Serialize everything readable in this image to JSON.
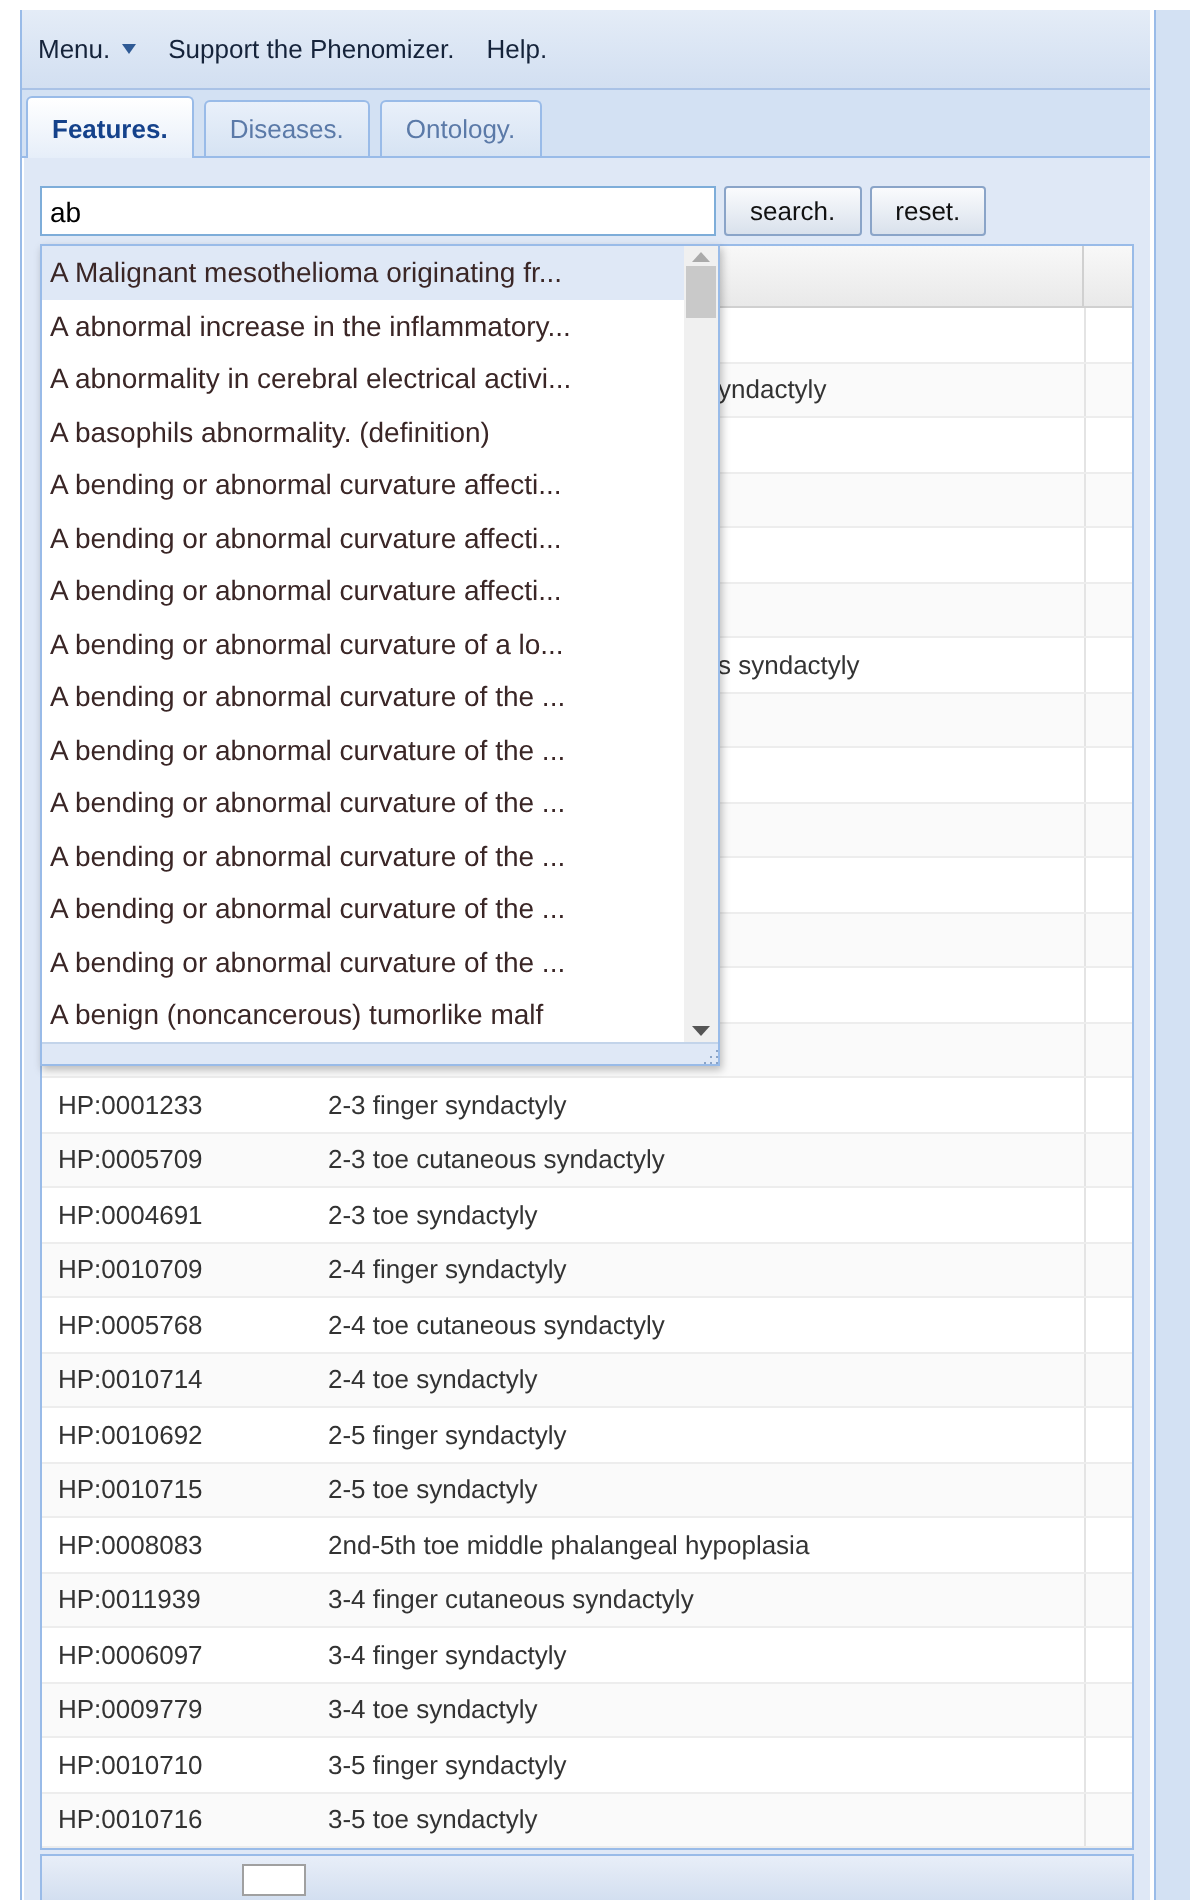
{
  "menu": [
    {
      "label": "Menu.",
      "kind": "dropdown"
    },
    {
      "label": "Support the Phenomizer.",
      "kind": "link"
    },
    {
      "label": "Help.",
      "kind": "link"
    }
  ],
  "tabs": [
    {
      "label": "Features.",
      "selected": true
    },
    {
      "label": "Diseases.",
      "selected": false
    },
    {
      "label": "Ontology.",
      "selected": false
    }
  ],
  "search": {
    "value": "ab",
    "buttons": [
      "search.",
      "reset."
    ]
  },
  "suggestions": [
    {
      "label": "A Malignant mesothelioma originating fr...",
      "selected": true
    },
    {
      "label": "A abnormal increase in the inflammatory...",
      "selected": false
    },
    {
      "label": "A abnormality in cerebral electrical activi...",
      "selected": false
    },
    {
      "label": "A basophils abnormality. (definition)",
      "selected": false
    },
    {
      "label": "A bending or abnormal curvature affecti...",
      "selected": false
    },
    {
      "label": "A bending or abnormal curvature affecti...",
      "selected": false
    },
    {
      "label": "A bending or abnormal curvature affecti...",
      "selected": false
    },
    {
      "label": "A bending or abnormal curvature of a lo...",
      "selected": false
    },
    {
      "label": "A bending or abnormal curvature of the ...",
      "selected": false
    },
    {
      "label": "A bending or abnormal curvature of the ...",
      "selected": false
    },
    {
      "label": "A bending or abnormal curvature of the ...",
      "selected": false
    },
    {
      "label": "A bending or abnormal curvature of the ...",
      "selected": false
    },
    {
      "label": "A bending or abnormal curvature of the ...",
      "selected": false
    },
    {
      "label": "A bending or abnormal curvature of the ...",
      "selected": false
    },
    {
      "label": "A benign (noncancerous) tumorlike malf",
      "selected": false
    }
  ],
  "grid": {
    "rows": [
      {
        "kind": "covered"
      },
      {
        "kind": "covered",
        "visible_text": "yndactyly"
      },
      {
        "kind": "covered"
      },
      {
        "kind": "covered"
      },
      {
        "kind": "covered"
      },
      {
        "kind": "covered"
      },
      {
        "kind": "covered",
        "visible_text": "s syndactyly"
      },
      {
        "kind": "covered"
      },
      {
        "kind": "covered"
      },
      {
        "kind": "covered"
      },
      {
        "kind": "covered"
      },
      {
        "kind": "covered"
      },
      {
        "kind": "covered"
      },
      {
        "kind": "covered"
      },
      {
        "kind": "term",
        "id": "HP:0001233",
        "name": "2-3 finger syndactyly"
      },
      {
        "kind": "term",
        "id": "HP:0005709",
        "name": "2-3 toe cutaneous syndactyly"
      },
      {
        "kind": "term",
        "id": "HP:0004691",
        "name": "2-3 toe syndactyly"
      },
      {
        "kind": "term",
        "id": "HP:0010709",
        "name": "2-4 finger syndactyly"
      },
      {
        "kind": "term",
        "id": "HP:0005768",
        "name": "2-4 toe cutaneous syndactyly"
      },
      {
        "kind": "term",
        "id": "HP:0010714",
        "name": "2-4 toe syndactyly"
      },
      {
        "kind": "term",
        "id": "HP:0010692",
        "name": "2-5 finger syndactyly"
      },
      {
        "kind": "term",
        "id": "HP:0010715",
        "name": "2-5 toe syndactyly"
      },
      {
        "kind": "term",
        "id": "HP:0008083",
        "name": "2nd-5th toe middle phalangeal hypoplasia"
      },
      {
        "kind": "term",
        "id": "HP:0011939",
        "name": "3-4 finger cutaneous syndactyly"
      },
      {
        "kind": "term",
        "id": "HP:0006097",
        "name": "3-4 finger syndactyly"
      },
      {
        "kind": "term",
        "id": "HP:0009779",
        "name": "3-4 toe syndactyly"
      },
      {
        "kind": "term",
        "id": "HP:0010710",
        "name": "3-5 finger syndactyly"
      },
      {
        "kind": "term",
        "id": "HP:0010716",
        "name": "3-5 toe syndactyly"
      }
    ]
  }
}
